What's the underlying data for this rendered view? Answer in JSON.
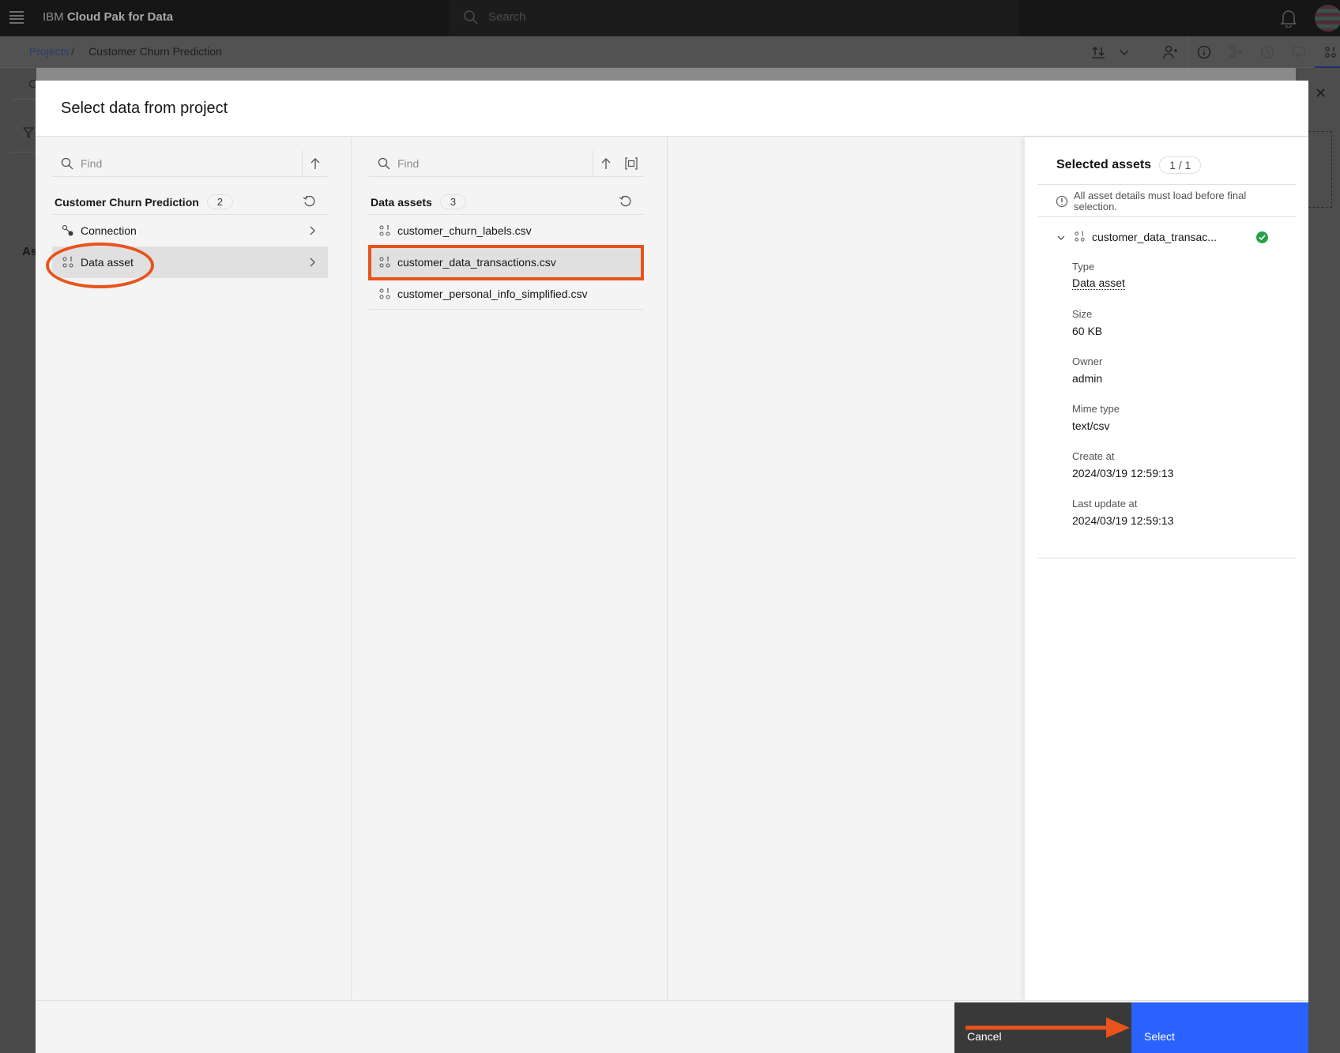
{
  "app": {
    "brand_prefix": "IBM",
    "brand_name": "Cloud Pak for Data",
    "search_placeholder": "Search"
  },
  "breadcrumb": {
    "root": "Projects",
    "separator": "/",
    "current": "Customer Churn Prediction"
  },
  "toolbar_icons": [
    "import-export-icon",
    "chevron-down-icon",
    "add-collaborator-icon",
    "info-icon",
    "lineage-icon",
    "history-icon",
    "comments-icon",
    "data-asset-icon"
  ],
  "underlay": {
    "partial_left_c": "C",
    "partial_left_as": "As"
  },
  "modal": {
    "title": "Select data from project",
    "column1": {
      "find_placeholder": "Find",
      "group_title": "Customer Churn Prediction",
      "group_count": "2",
      "items": [
        {
          "label": "Connection",
          "icon": "connection-icon",
          "selected": false
        },
        {
          "label": "Data asset",
          "icon": "data-asset-icon",
          "selected": true
        }
      ]
    },
    "column2": {
      "find_placeholder": "Find",
      "group_title": "Data assets",
      "group_count": "3",
      "items": [
        {
          "label": "customer_churn_labels.csv",
          "selected": false
        },
        {
          "label": "customer_data_transactions.csv",
          "selected": true
        },
        {
          "label": "customer_personal_info_simplified.csv",
          "selected": false
        }
      ]
    },
    "selected_panel": {
      "title": "Selected assets",
      "count": "1 / 1",
      "notice": "All asset details must load before final selection.",
      "asset_name": "customer_data_transac...",
      "status": "loaded",
      "details": [
        {
          "label": "Type",
          "value": "Data asset"
        },
        {
          "label": "Size",
          "value": "60 KB"
        },
        {
          "label": "Owner",
          "value": "admin"
        },
        {
          "label": "Mime type",
          "value": "text/csv"
        },
        {
          "label": "Create at",
          "value": "2024/03/19 12:59:13"
        },
        {
          "label": "Last update at",
          "value": "2024/03/19 12:59:13"
        }
      ]
    },
    "footer": {
      "cancel_label": "Cancel",
      "select_label": "Select"
    }
  },
  "colors": {
    "primary_button": "#2962ff",
    "annotation": "#e8531c",
    "success": "#24a148"
  }
}
